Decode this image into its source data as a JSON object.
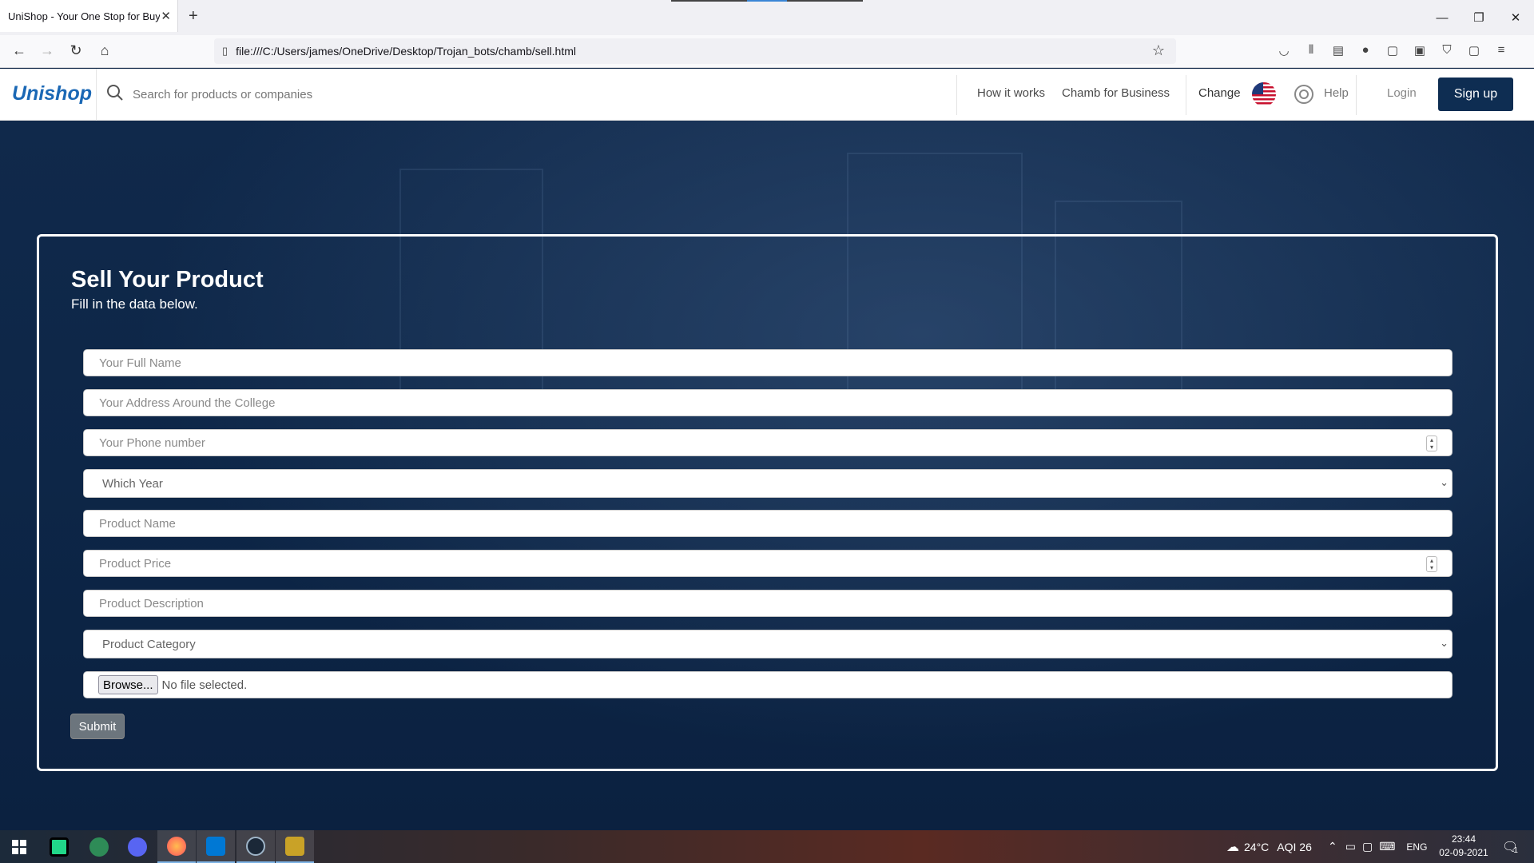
{
  "browser": {
    "tab_title": "UniShop - Your One Stop for Buying",
    "url": "file:///C:/Users/james/OneDrive/Desktop/Trojan_bots/chamb/sell.html"
  },
  "header": {
    "logo": "Unishop",
    "search_placeholder": "Search for products or companies",
    "nav": {
      "how_it_works": "How it works",
      "business": "Chamb for Business",
      "change": "Change",
      "help": "Help",
      "login": "Login",
      "signup": "Sign up"
    }
  },
  "form": {
    "title": "Sell Your Product",
    "subtitle": "Fill in the data below.",
    "fields": {
      "full_name": "Your Full Name",
      "address": "Your Address Around the College",
      "phone": "Your Phone number",
      "year": "Which Year",
      "product_name": "Product Name",
      "product_price": "Product Price",
      "product_description": "Product Description",
      "product_category": "Product Category"
    },
    "file": {
      "browse": "Browse...",
      "status": "No file selected."
    },
    "submit": "Submit"
  },
  "taskbar": {
    "weather": "24°C",
    "aqi": "AQI 26",
    "lang": "ENG",
    "time": "23:44",
    "date": "02-09-2021",
    "notifications": "1"
  },
  "colors": {
    "brand": "#1b68b5",
    "signup_bg": "#0e2d52",
    "hero_bg": "#0c2444",
    "submit_bg": "#6c757d"
  }
}
